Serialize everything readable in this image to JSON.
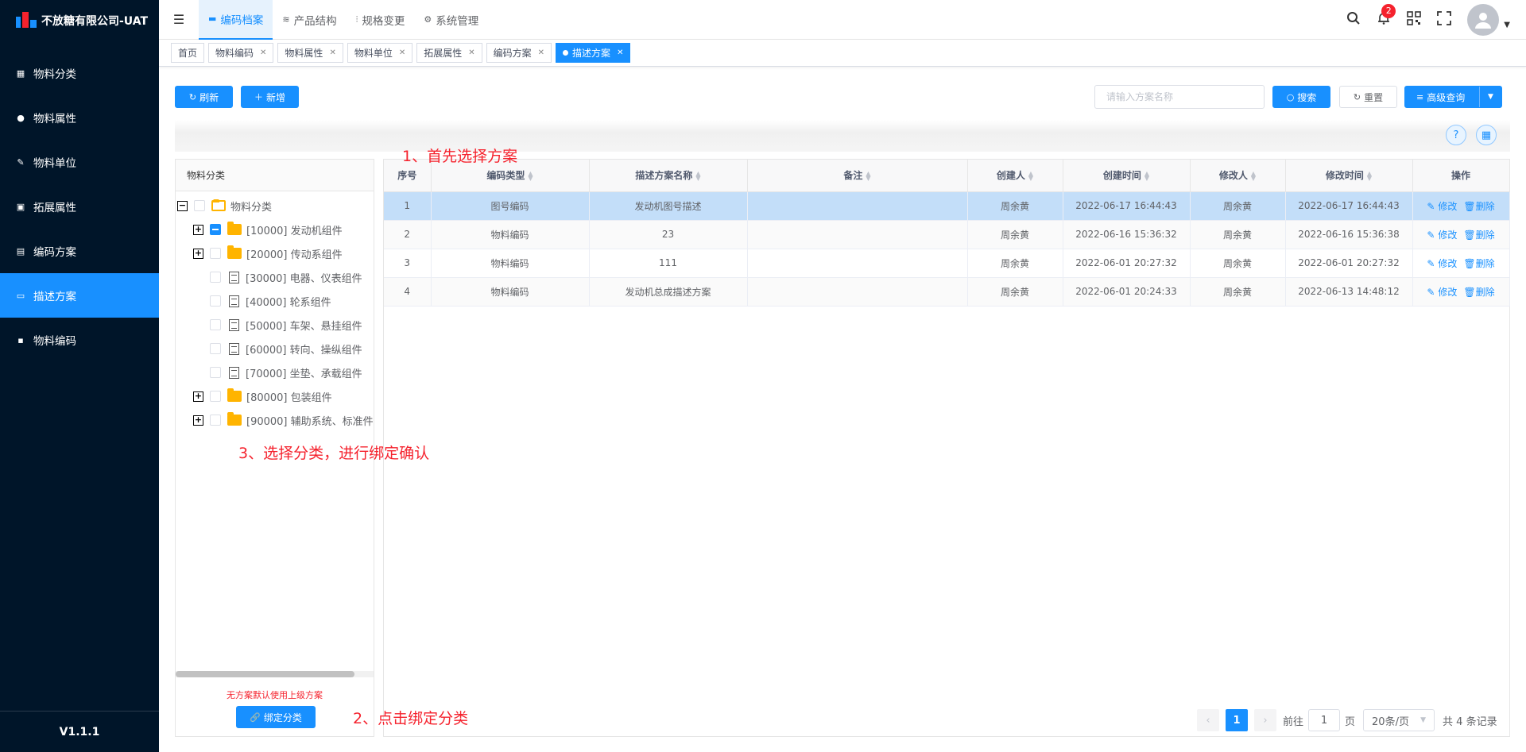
{
  "app": {
    "title": "不放糖有限公司-UAT",
    "version": "V1.1.1"
  },
  "colors": {
    "sidebar_bg": "#001529",
    "accent": "#1890ff",
    "annotation": "#f5222d"
  },
  "sidebar": {
    "items": [
      {
        "label": "物料分类",
        "icon": "grid-icon"
      },
      {
        "label": "物料属性",
        "icon": "info-icon"
      },
      {
        "label": "物料单位",
        "icon": "pencil-icon"
      },
      {
        "label": "拓展属性",
        "icon": "image-icon"
      },
      {
        "label": "编码方案",
        "icon": "doc-icon"
      },
      {
        "label": "描述方案",
        "icon": "monitor-icon",
        "active": true
      },
      {
        "label": "物料编码",
        "icon": "file-icon"
      }
    ]
  },
  "topnav": {
    "items": [
      {
        "label": "编码档案",
        "active": true
      },
      {
        "label": "产品结构"
      },
      {
        "label": "规格变更"
      },
      {
        "label": "系统管理"
      }
    ]
  },
  "header": {
    "notification_count": "2"
  },
  "tags": [
    {
      "label": "首页"
    },
    {
      "label": "物料编码"
    },
    {
      "label": "物料属性"
    },
    {
      "label": "物料单位"
    },
    {
      "label": "拓展属性"
    },
    {
      "label": "编码方案"
    },
    {
      "label": "描述方案",
      "active": true
    }
  ],
  "toolbar": {
    "refresh_label": "刷新",
    "add_label": "新增",
    "search_placeholder": "请输入方案名称",
    "search_label": "搜索",
    "reset_label": "重置",
    "advanced_label": "高级查询"
  },
  "tree": {
    "title": "物料分类",
    "root": "物料分类",
    "nodes": [
      {
        "label": "[10000] 发动机组件"
      },
      {
        "label": "[20000] 传动系组件"
      },
      {
        "label": "[30000] 电器、仪表组件"
      },
      {
        "label": "[40000] 轮系组件"
      },
      {
        "label": "[50000] 车架、悬挂组件"
      },
      {
        "label": "[60000] 转向、操纵组件"
      },
      {
        "label": "[70000] 坐垫、承载组件"
      },
      {
        "label": "[80000] 包装组件"
      },
      {
        "label": "[90000] 辅助系统、标准件"
      }
    ],
    "note": "无方案默认使用上级方案",
    "bind_label": "绑定分类"
  },
  "table": {
    "columns": [
      "序号",
      "编码类型",
      "描述方案名称",
      "备注",
      "创建人",
      "创建时间",
      "修改人",
      "修改时间",
      "操作"
    ],
    "rows": [
      {
        "no": "1",
        "type": "图号编码",
        "name": "发动机图号描述",
        "remark": "",
        "creator": "周余黄",
        "created": "2022-06-17 16:44:43",
        "modifier": "周余黄",
        "modified": "2022-06-17 16:44:43"
      },
      {
        "no": "2",
        "type": "物料编码",
        "name": "23",
        "remark": "",
        "creator": "周余黄",
        "created": "2022-06-16 15:36:32",
        "modifier": "周余黄",
        "modified": "2022-06-16 15:36:38"
      },
      {
        "no": "3",
        "type": "物料编码",
        "name": "111",
        "remark": "",
        "creator": "周余黄",
        "created": "2022-06-01 20:27:32",
        "modifier": "周余黄",
        "modified": "2022-06-01 20:27:32"
      },
      {
        "no": "4",
        "type": "物料编码",
        "name": "发动机总成描述方案",
        "remark": "",
        "creator": "周余黄",
        "created": "2022-06-01 20:24:33",
        "modifier": "周余黄",
        "modified": "2022-06-13 14:48:12"
      }
    ],
    "edit_label": "修改",
    "delete_label": "删除"
  },
  "pagination": {
    "current": "1",
    "goto_label": "前往",
    "goto_value": "1",
    "page_unit": "页",
    "page_size": "20条/页",
    "total": "共 4 条记录"
  },
  "annotations": {
    "step1": "1、首先选择方案",
    "step2": "2、点击绑定分类",
    "step3": "3、选择分类，进行绑定确认"
  }
}
